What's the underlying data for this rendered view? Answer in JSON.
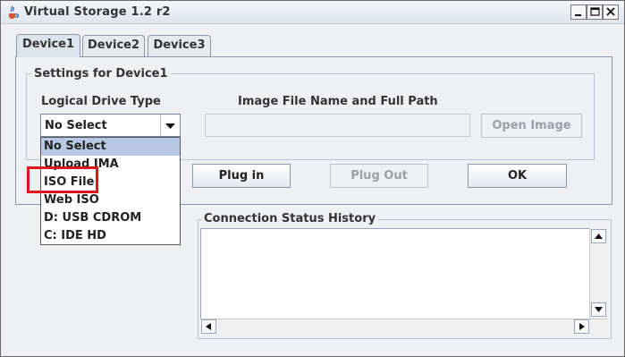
{
  "window": {
    "title": "Virtual Storage  1.2 r2"
  },
  "tabs": [
    {
      "label": "Device1",
      "active": true
    },
    {
      "label": "Device2",
      "active": false
    },
    {
      "label": "Device3",
      "active": false
    }
  ],
  "settings": {
    "group_title": "Settings for Device1",
    "logical_drive_label": "Logical Drive Type",
    "image_file_label": "Image File Name and Full Path",
    "logical_drive_value": "No Select",
    "image_path_value": "",
    "open_image_label": "Open Image"
  },
  "dropdown": {
    "options": [
      "No Select",
      "Upload IMA",
      "ISO File",
      "Web ISO",
      "D: USB CDROM",
      "C: IDE HD"
    ],
    "selected": "No Select"
  },
  "actions": {
    "plug_in_label": "Plug in",
    "plug_out_label": "Plug Out",
    "ok_label": "OK"
  },
  "status": {
    "title": "Connection Status History"
  },
  "colors": {
    "highlight": "#e0151a",
    "selection": "#b8c8e4"
  },
  "icons": {
    "app": "java-cup-icon",
    "combo_arrow": "chevron-down-icon"
  }
}
